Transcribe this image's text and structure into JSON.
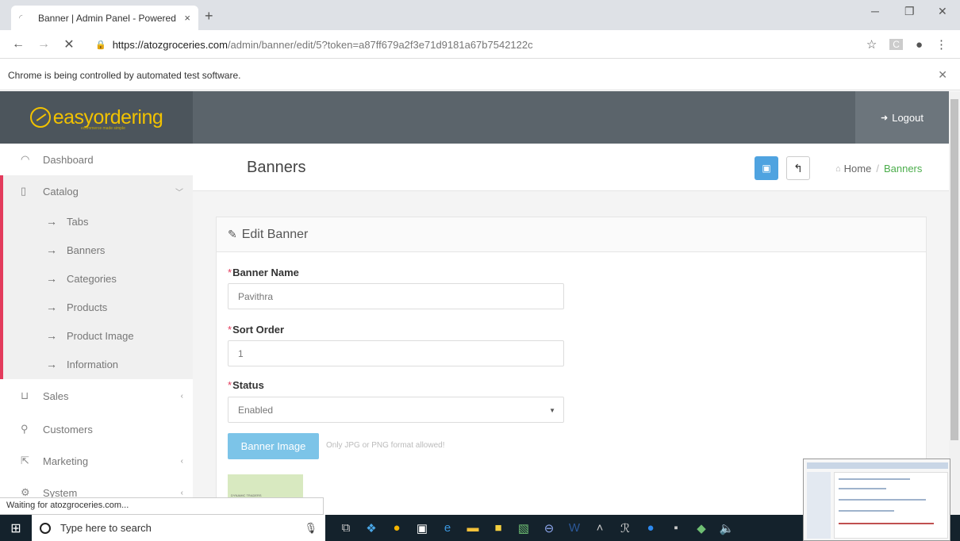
{
  "browser": {
    "tab_title": "Banner | Admin Panel - Powered",
    "tab_close": "×",
    "new_tab": "+",
    "url_host": "https://atozgroceries.com",
    "url_path": "/admin/banner/edit/5?token=a87ff679a2f3e71d9181a67b7542122c",
    "infobar_text": "Chrome is being controlled by automated test software.",
    "status_text": "Waiting for atozgroceries.com..."
  },
  "header": {
    "logo_text": "easyordering",
    "logo_tagline": "ecommerce made simple",
    "logout_label": "Logout"
  },
  "sidebar": {
    "dashboard": "Dashboard",
    "catalog": "Catalog",
    "catalog_items": [
      "Tabs",
      "Banners",
      "Categories",
      "Products",
      "Product Image",
      "Information"
    ],
    "sales": "Sales",
    "customers": "Customers",
    "marketing": "Marketing",
    "system": "System"
  },
  "page": {
    "title": "Banners",
    "breadcrumb_home": "Home",
    "breadcrumb_sep": "/",
    "breadcrumb_current": "Banners"
  },
  "form": {
    "heading": "Edit Banner",
    "banner_name_label": "Banner Name",
    "banner_name_value": "Pavithra",
    "sort_order_label": "Sort Order",
    "sort_order_value": "1",
    "status_label": "Status",
    "status_value": "Enabled",
    "image_button": "Banner Image",
    "image_hint": "Only JPG or PNG format allowed!",
    "thumb_text": "DYNAMIC TRADERS"
  },
  "taskbar": {
    "search_placeholder": "Type here to search"
  },
  "colors": {
    "accent_red": "#e33b5c",
    "logo_yellow": "#f2c200",
    "primary_blue": "#4fa3e0",
    "breadcrumb_green": "#4cae4c",
    "topnav": "#5b646b"
  }
}
